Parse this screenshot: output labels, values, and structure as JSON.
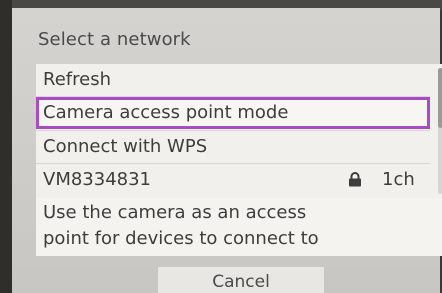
{
  "dialog": {
    "title": "Select a network"
  },
  "network_list": {
    "items": [
      {
        "label": "Refresh"
      },
      {
        "label": "Camera access point mode",
        "selected": true
      },
      {
        "label": "Connect with WPS"
      },
      {
        "label": "VM8334831",
        "secured": true,
        "lock_icon": "lock-icon",
        "channel": "1ch"
      }
    ],
    "highlight_color": "#a94bc6"
  },
  "description": {
    "line1": "Use the camera as an access",
    "line2": "point for devices to connect to"
  },
  "footer": {
    "cancel_label": "Cancel"
  }
}
